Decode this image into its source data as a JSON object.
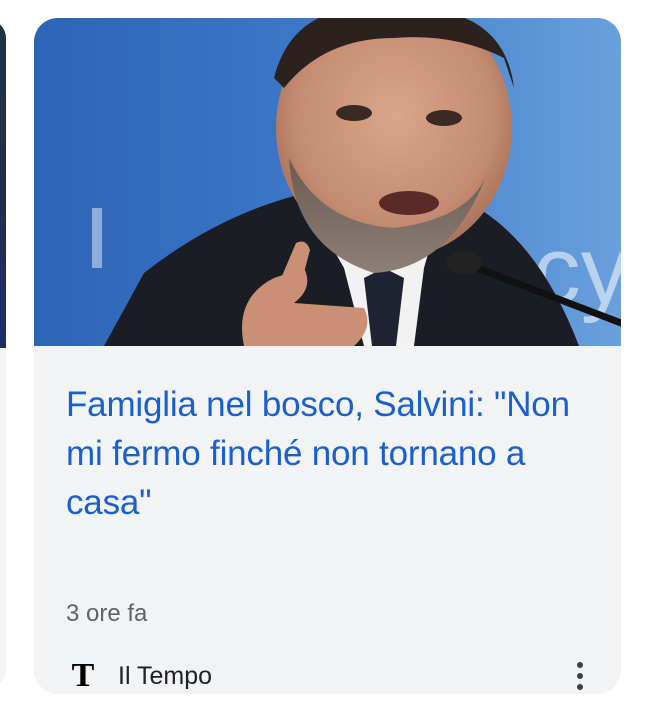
{
  "article": {
    "headline": "Famiglia nel bosco, Salvini: \"Non mi fermo finché non tornano a casa\"",
    "timestamp": "3 ore fa",
    "source": {
      "logo_letter": "T",
      "name": "Il Tempo"
    },
    "image": {
      "background_text": "ocy"
    },
    "more_icon": "more-vert-icon"
  },
  "colors": {
    "headline": "#1a5fd0",
    "card_background": "#f1f3f4",
    "timestamp": "#5f6368"
  }
}
